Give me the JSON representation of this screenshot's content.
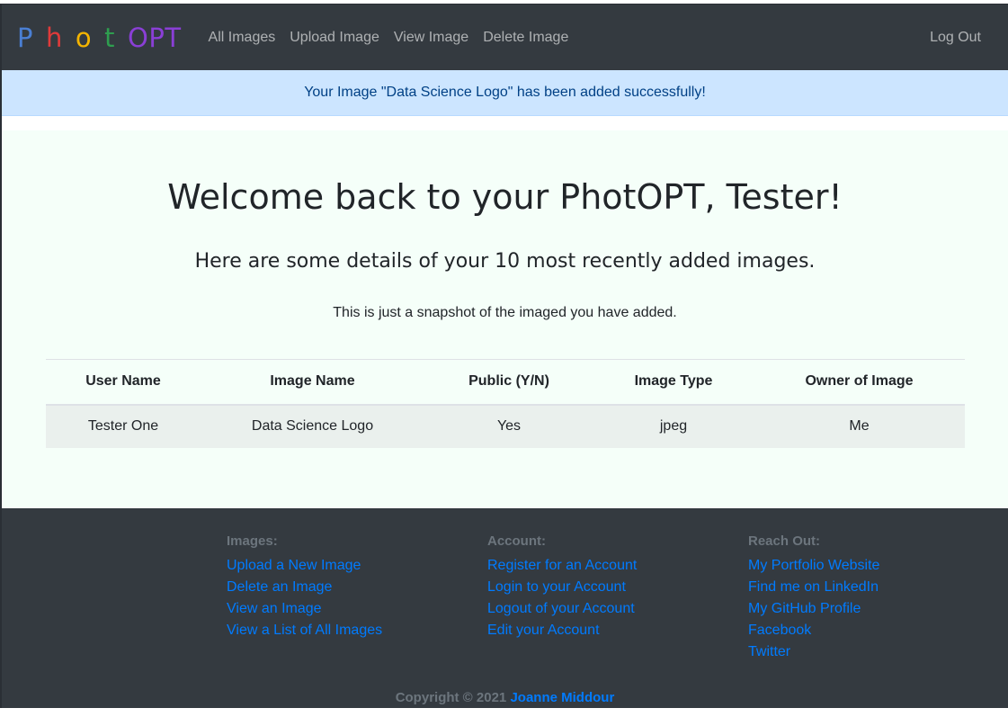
{
  "navbar": {
    "brand_letters": [
      {
        "char": "P",
        "color": "#4a7fd4"
      },
      {
        "char": "h",
        "color": "#e03a3a"
      },
      {
        "char": "o",
        "color": "#f4b400"
      },
      {
        "char": "t",
        "color": "#2e9e4f"
      },
      {
        "char": "OPT",
        "color": "#8a3fd6"
      }
    ],
    "links": [
      "All Images",
      "Upload Image",
      "View Image",
      "Delete Image"
    ],
    "logout": "Log Out"
  },
  "alert": {
    "message": "Your Image \"Data Science Logo\" has been added successfully!"
  },
  "main": {
    "title": "Welcome back to your PhotOPT, Tester!",
    "subtitle": "Here are some details of your 10 most recently added images.",
    "lead": "This is just a snapshot of the imaged you have added.",
    "table": {
      "headers": [
        "User Name",
        "Image Name",
        "Public (Y/N)",
        "Image Type",
        "Owner of Image"
      ],
      "rows": [
        [
          "Tester One",
          "Data Science Logo",
          "Yes",
          "jpeg",
          "Me"
        ]
      ]
    }
  },
  "footer": {
    "images": {
      "heading": "Images:",
      "links": [
        "Upload a New Image",
        "Delete an Image",
        "View an Image",
        "View a List of All Images"
      ]
    },
    "account": {
      "heading": "Account:",
      "links": [
        "Register for an Account",
        "Login to your Account",
        "Logout of your Account",
        "Edit your Account"
      ]
    },
    "reach": {
      "heading": "Reach Out:",
      "links": [
        "My Portfolio Website",
        "Find me on LinkedIn",
        "My GitHub Profile",
        "Facebook",
        "Twitter"
      ]
    },
    "copyright_prefix": "Copyright © 2021",
    "author": "Joanne Middour"
  }
}
